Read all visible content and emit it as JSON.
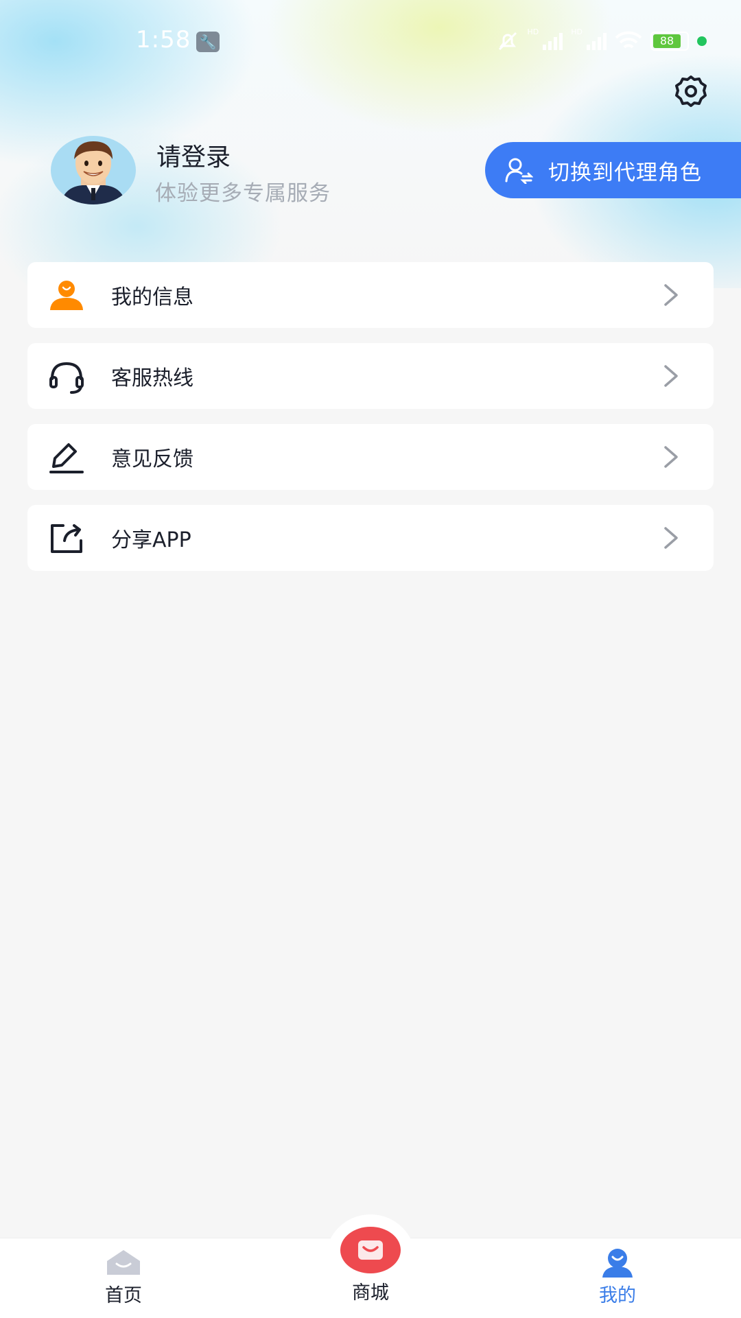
{
  "status_bar": {
    "time": "1:58",
    "battery": "88"
  },
  "profile": {
    "title": "请登录",
    "subtitle": "体验更多专属服务",
    "switch_role_label": "切换到代理角色"
  },
  "menu": [
    {
      "label": "我的信息",
      "icon": "user-info-icon"
    },
    {
      "label": "客服热线",
      "icon": "headset-icon"
    },
    {
      "label": "意见反馈",
      "icon": "edit-pen-icon"
    },
    {
      "label": "分享APP",
      "icon": "share-icon"
    }
  ],
  "bottom_nav": {
    "home": "首页",
    "shop": "商城",
    "mine": "我的"
  },
  "colors": {
    "accent": "#3d7cf5",
    "orange": "#ff8a00",
    "shop_red": "#ee4a4f",
    "active_nav": "#3a7de8"
  }
}
